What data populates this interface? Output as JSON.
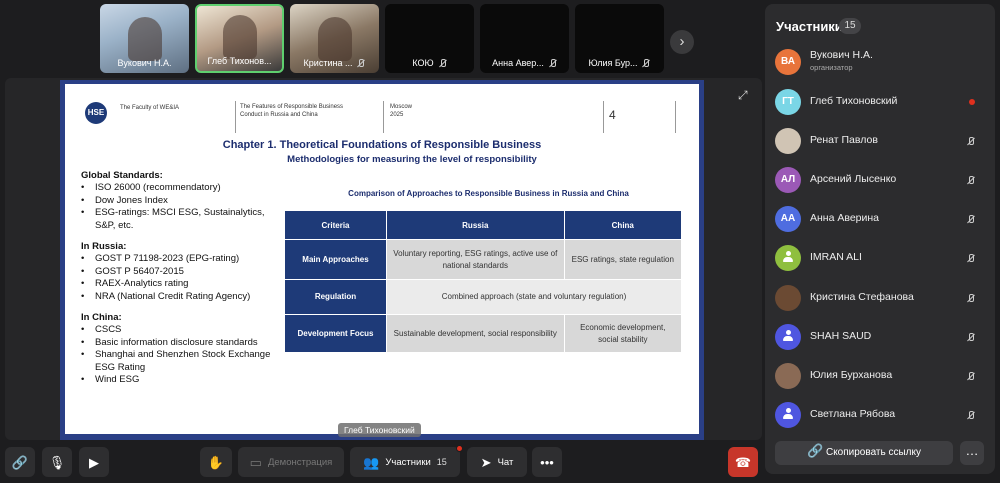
{
  "tiles": [
    {
      "label": "Вукович Н.А.",
      "muted": false
    },
    {
      "label": "Глеб Тихонов...",
      "muted": false
    },
    {
      "label": "Кристина ...",
      "muted": true
    },
    {
      "label": "КОЮ",
      "muted": true
    },
    {
      "label": "Анна Авер...",
      "muted": true
    },
    {
      "label": "Юлия Бур...",
      "muted": true
    }
  ],
  "slide": {
    "faculty": "The Faculty of WE&IA",
    "header_title_line1": "The Features of Responsible Business",
    "header_title_line2": "Conduct in Russia and China",
    "city": "Moscow",
    "year": "2025",
    "page_number": "4",
    "title": "Chapter 1. Theoretical Foundations of Responsible Business",
    "subtitle": "Methodologies for measuring the level of responsibility",
    "sections": [
      {
        "heading": "Global Standards:",
        "items": [
          "ISO 26000 (recommendatory)",
          "Dow Jones Index",
          "ESG-ratings: MSCI ESG, Sustainalytics, S&P, etc."
        ]
      },
      {
        "heading": "In Russia:",
        "items": [
          "GOST P 71198-2023 (EPG-rating)",
          "GOST P 56407-2015",
          "RAEX-Analytics rating",
          "NRA (National Credit Rating Agency)"
        ]
      },
      {
        "heading": "In China:",
        "items": [
          "CSCS",
          "Basic information disclosure standards",
          "Shanghai and Shenzhen Stock Exchange ESG Rating",
          "Wind ESG"
        ]
      }
    ],
    "table_caption": "Comparison of Approaches to Responsible Business in Russia and China",
    "table_headers": [
      "Criteria",
      "Russia",
      "China"
    ],
    "table_rows": [
      {
        "criteria": "Main Approaches",
        "russia": "Voluntary reporting, ESG ratings, active use of national standards",
        "china": "ESG ratings, state regulation"
      },
      {
        "criteria": "Regulation",
        "combined": "Combined approach (state and voluntary regulation)"
      },
      {
        "criteria": "Development Focus",
        "russia": "Sustainable development, social responsibility",
        "china": "Economic development, social stability"
      }
    ]
  },
  "speaker_tag": "Глеб Тихоновский",
  "panel": {
    "title": "Участники",
    "count": "15",
    "participants": [
      {
        "initials": "ВА",
        "name": "Вукович Н.А.",
        "role": "организатор",
        "color": "#e8743b"
      },
      {
        "initials": "ГТ",
        "name": "Глеб Тихоновский",
        "color": "#7ad6e6"
      },
      {
        "initials": "",
        "name": "Ренат Павлов",
        "color": "#d0c4b4"
      },
      {
        "initials": "АЛ",
        "name": "Арсений Лысенко",
        "color": "#9b59b6"
      },
      {
        "initials": "АА",
        "name": "Анна Аверина",
        "color": "#4f6de0"
      },
      {
        "initials": "",
        "name": "IMRAN ALI",
        "color": "#8fbf3f"
      },
      {
        "initials": "",
        "name": "Кристина Стефанова",
        "color": "#6b4a33"
      },
      {
        "initials": "",
        "name": "SHAH SAUD",
        "color": "#4f56e0"
      },
      {
        "initials": "",
        "name": "Юлия Бурханова",
        "color": "#8a6a55"
      },
      {
        "initials": "",
        "name": "Светлана Рябова",
        "color": "#4f56e0"
      }
    ],
    "copy_link": "Скопировать ссылку"
  },
  "toolbar": {
    "demo": "Демонстрация",
    "participants": "Участники",
    "participants_count": "15",
    "chat": "Чат"
  }
}
